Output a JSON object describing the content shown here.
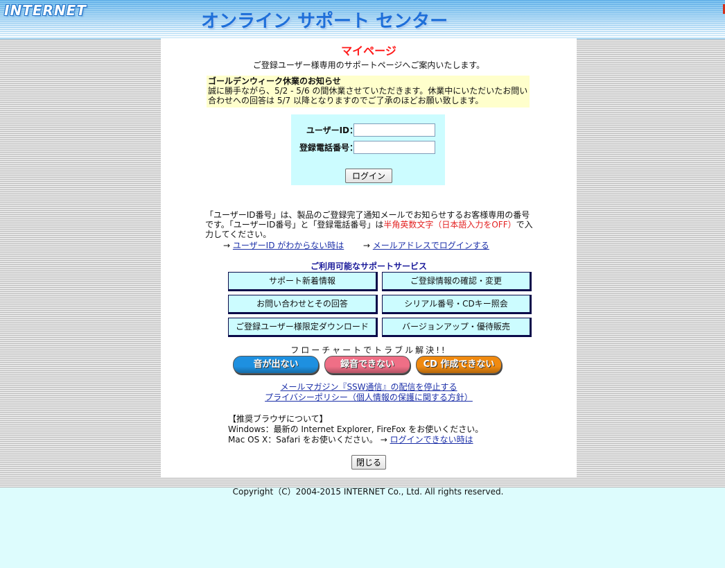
{
  "header": {
    "logo": "INTERNET",
    "title": "オンライン サポート センター"
  },
  "main": {
    "heading": "マイページ",
    "intro": "ご登録ユーザー様専用のサポートページへご案内いたします。",
    "notice": {
      "title": "ゴールデンウィーク休業のお知らせ",
      "body": "誠に勝手ながら、5/2 - 5/6 の間休業させていただきます。休業中にいただいたお問い合わせへの回答は 5/7 以降となりますのでご了承のほどお願い致します。"
    },
    "login": {
      "user_id_label": "ユーザーID：",
      "phone_label": "登録電話番号：",
      "user_id_value": "",
      "phone_value": "",
      "button": "ログイン"
    },
    "info": {
      "text_before": "「ユーザーID番号」は、製品のご登録完了通知メールでお知らせするお客様専用の番号です。「ユーザーID番号」と「登録電話番号」は",
      "text_red": "半角英数文字（日本語入力をOFF）",
      "text_after": "で入力してください。"
    },
    "help_links": {
      "arrow": "→",
      "forgot_id": "ユーザーID がわからない時は",
      "email_login": "メールアドレスでログインする"
    },
    "services": {
      "title": "ご利用可能なサポートサービス",
      "items": [
        "サポート新着情報",
        "ご登録情報の確認・変更",
        "お問い合わせとその回答",
        "シリアル番号・CDキー照会",
        "ご登録ユーザー様限定ダウンロード",
        "バージョンアップ・優待販売"
      ]
    },
    "flowchart": {
      "title": "フローチャートでトラブル解決!!",
      "buttons": [
        "音が出ない",
        "録音できない",
        "CD 作成できない"
      ],
      "colors": [
        "#1e90e0",
        "#ef6f86",
        "#f08a10"
      ]
    },
    "bottom_links": {
      "newsletter": "メールマガジン『SSW通信』の配信を停止する",
      "privacy": "プライバシーポリシー（個人情報の保護に関する方針）"
    },
    "browser": {
      "heading": "【推奨ブラウザについて】",
      "windows": "Windows：最新の Internet Explorer, FireFox をお使いください。",
      "mac": "Mac OS X：Safari をお使いください。",
      "arrow": "→",
      "login_trouble": "ログインできない時は"
    },
    "close_button": "閉じる"
  },
  "footer": {
    "copyright": "Copyright（C）2004-2015 INTERNET Co., Ltd. All rights reserved."
  }
}
